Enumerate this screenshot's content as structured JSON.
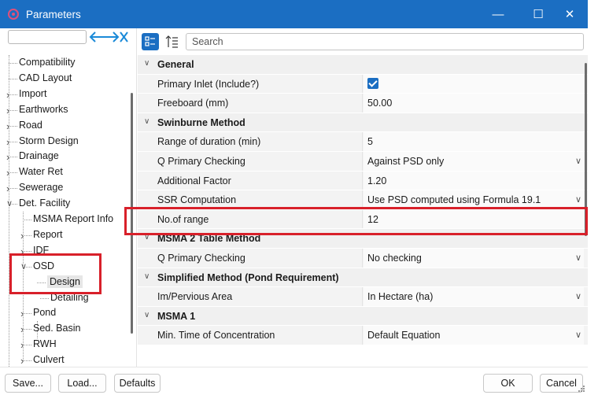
{
  "window": {
    "title": "Parameters",
    "minimize_glyph": "—",
    "maximize_glyph": "☐",
    "close_glyph": "✕",
    "accent_color": "#1b6ec2"
  },
  "toolbar": {
    "search_placeholder": "Search",
    "categorized_icon": "categorized-view-icon",
    "sort_icon": "alphabetical-sort-icon"
  },
  "tree": {
    "items": [
      {
        "label": "Compatibility"
      },
      {
        "label": "CAD Layout"
      },
      {
        "label": "Import",
        "expander": ">"
      },
      {
        "label": "Earthworks",
        "expander": ">"
      },
      {
        "label": "Road",
        "expander": ">"
      },
      {
        "label": "Storm Design",
        "expander": ">"
      },
      {
        "label": "Drainage",
        "expander": ">"
      },
      {
        "label": "Water Ret",
        "expander": ">"
      },
      {
        "label": "Sewerage",
        "expander": ">"
      },
      {
        "label": "Det. Facility",
        "expander": "v"
      },
      {
        "label": "MSMA Report Info"
      },
      {
        "label": "Report",
        "expander": ">"
      },
      {
        "label": "IDF",
        "expander": ">"
      },
      {
        "label": "OSD",
        "expander": "v"
      },
      {
        "label": "Design",
        "selected": true
      },
      {
        "label": "Detailing"
      },
      {
        "label": "Pond",
        "expander": ">"
      },
      {
        "label": "Sed. Basin",
        "expander": ">"
      },
      {
        "label": "RWH",
        "expander": ">"
      },
      {
        "label": "Culvert",
        "expander": ">"
      }
    ]
  },
  "grid": {
    "rows": [
      {
        "type": "category",
        "label": "General"
      },
      {
        "type": "property",
        "name": "Primary Inlet (Include?)",
        "value": "",
        "checkbox": true
      },
      {
        "type": "property",
        "name": "Freeboard (mm)",
        "value": "50.00"
      },
      {
        "type": "category",
        "label": "Swinburne Method"
      },
      {
        "type": "property",
        "name": "Range of duration (min)",
        "value": "5"
      },
      {
        "type": "property",
        "name": "Q Primary Checking",
        "value": "Against PSD only",
        "dropdown": true
      },
      {
        "type": "property",
        "name": "Additional Factor",
        "value": "1.20"
      },
      {
        "type": "property",
        "name": "SSR Computation",
        "value": "Use PSD computed using Formula 19.1",
        "dropdown": true
      },
      {
        "type": "property",
        "name": "No.of range",
        "value": "12"
      },
      {
        "type": "category",
        "label": "MSMA 2 Table Method"
      },
      {
        "type": "property",
        "name": "Q Primary Checking",
        "value": "No checking",
        "dropdown": true
      },
      {
        "type": "category",
        "label": "Simplified Method (Pond Requirement)"
      },
      {
        "type": "property",
        "name": "Im/Pervious Area",
        "value": "In Hectare (ha)",
        "dropdown": true
      },
      {
        "type": "category",
        "label": "MSMA 1"
      },
      {
        "type": "property",
        "name": "Min. Time of Concentration",
        "value": "Default Equation",
        "dropdown": true
      }
    ]
  },
  "buttons": {
    "save": "Save...",
    "load": "Load...",
    "defaults": "Defaults",
    "ok": "OK",
    "cancel": "Cancel"
  },
  "highlight_color": "#d8202a"
}
